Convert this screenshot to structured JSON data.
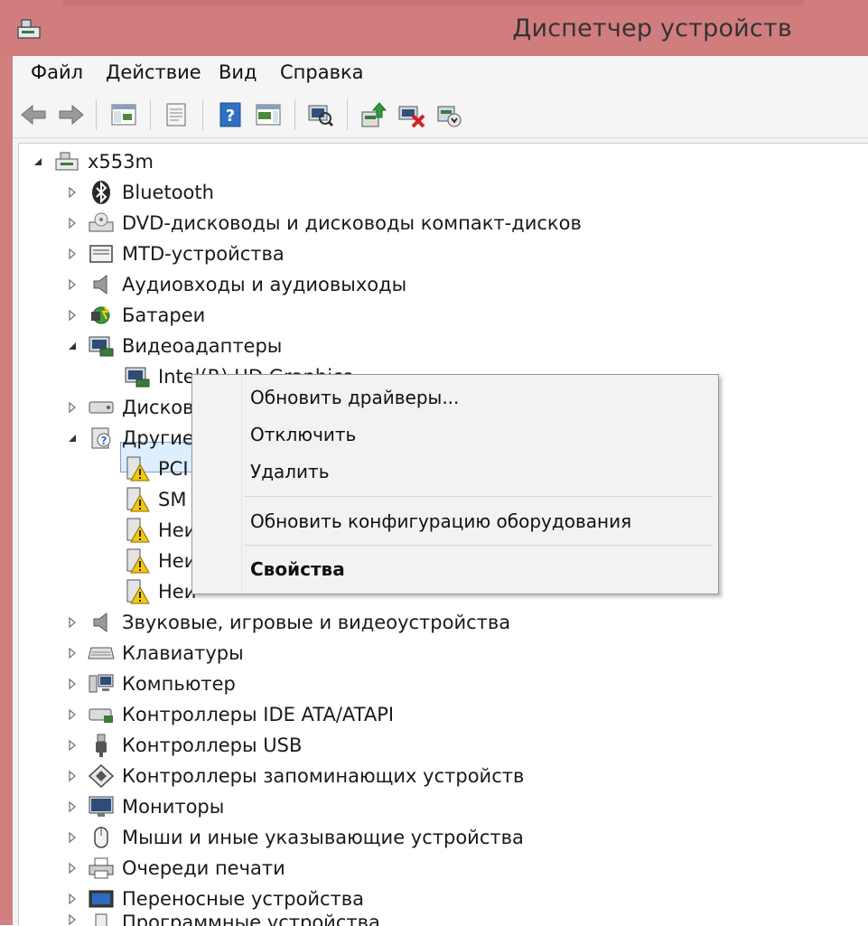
{
  "window": {
    "title": "Диспетчер устройств"
  },
  "menu": [
    "Файл",
    "Действие",
    "Вид",
    "Справка"
  ],
  "toolbar": {
    "buttons": [
      "back-icon",
      "forward-icon",
      "show-hide-console-tree-icon",
      "properties-icon",
      "help-icon",
      "action-pane-icon",
      "scan-hardware-icon",
      "update-driver-icon",
      "uninstall-icon",
      "disable-icon"
    ]
  },
  "tree": {
    "root": "x553m",
    "items": [
      "Bluetooth",
      "DVD-дисководы и дисководы компакт-дисков",
      "MTD-устройства",
      "Аудиовходы и аудиовыходы",
      "Батареи",
      "Видеоадаптеры",
      "Intel(R) HD Graphics",
      "Дисков",
      "Другие",
      "PCI",
      "SM",
      "Неи",
      "Неи",
      "Неи",
      "Звуковые, игровые и видеоустройства",
      "Клавиатуры",
      "Компьютер",
      "Контроллеры IDE ATA/ATAPI",
      "Контроллеры USB",
      "Контроллеры запоминающих устройств",
      "Мониторы",
      "Мыши и иные указывающие устройства",
      "Очереди печати",
      "Переносные устройства",
      "Программные устройства"
    ]
  },
  "context_menu": {
    "update_drivers": "Обновить драйверы...",
    "disable": "Отключить",
    "uninstall": "Удалить",
    "scan_hardware": "Обновить конфигурацию оборудования",
    "properties": "Свойства"
  },
  "colors": {
    "title_bar": "#d17d7e",
    "selection": "#ddeeff",
    "selection_border": "#7da2ce",
    "warning": "#f2c811"
  }
}
